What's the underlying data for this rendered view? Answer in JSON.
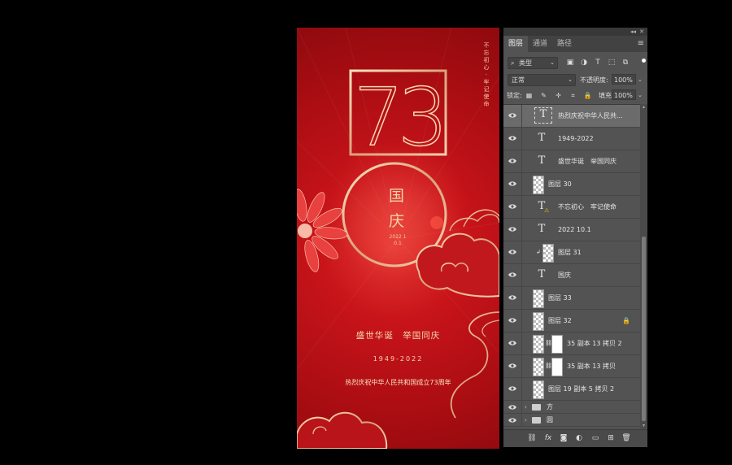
{
  "poster": {
    "big_number": "73",
    "vertical_motto": "不忘初心·牢记使命",
    "circle_title": "国庆",
    "circle_date": "2022 10.1",
    "slogan": "盛世华诞　举国同庆",
    "years": "1949-2022",
    "celebrate": "热烈庆祝中华人民共和国成立73周年"
  },
  "panel": {
    "collapse_glyph": "◂◂",
    "close_glyph": "✕",
    "tabs": [
      "图层",
      "通道",
      "路径"
    ],
    "active_tab": 0,
    "menu_glyph": "≡",
    "filter": {
      "icon": "⌕",
      "label": "类型",
      "chevron": "⌄"
    },
    "filter_icons": [
      "image-filter-icon",
      "adjustment-filter-icon",
      "type-filter-icon",
      "shape-filter-icon",
      "smart-object-filter-icon"
    ],
    "filter_glyphs": [
      "▣",
      "◑",
      "T",
      "⬚",
      "⧉"
    ],
    "blend_mode": "正常",
    "blend_chevron": "⌄",
    "opacity_label": "不透明度:",
    "opacity_value": "100%",
    "lock_label": "锁定:",
    "lock_glyphs": [
      "▦",
      "✎",
      "✛",
      "⌗",
      "🔒"
    ],
    "fill_label": "填充:",
    "fill_value": "100%",
    "chevron": "⌄",
    "layers": [
      {
        "name": "热烈庆祝中华人民共...",
        "kind": "text",
        "selected": true
      },
      {
        "name": "1949-2022",
        "kind": "text"
      },
      {
        "name": "盛世华诞　举国同庆",
        "kind": "text"
      },
      {
        "name": "图层 30",
        "kind": "pixel"
      },
      {
        "name": "不忘初心　牢记使命",
        "kind": "text",
        "warning": true
      },
      {
        "name": "2022 10.1",
        "kind": "text"
      },
      {
        "name": "图层 31",
        "kind": "pixel",
        "clipped": true
      },
      {
        "name": "国庆",
        "kind": "text"
      },
      {
        "name": "图层 33",
        "kind": "pixel"
      },
      {
        "name": "图层 32",
        "kind": "pixel",
        "locked": true
      },
      {
        "name": "35 副本 13 拷贝 2",
        "kind": "masked"
      },
      {
        "name": "35 副本 13 拷贝",
        "kind": "masked"
      },
      {
        "name": "图层 19 副本 5 拷贝 2",
        "kind": "pixel"
      },
      {
        "name": "方",
        "kind": "group"
      },
      {
        "name": "圆",
        "kind": "group"
      }
    ],
    "type_glyph": "T",
    "link_glyph": "⛓",
    "clip_glyph": "↲",
    "lock_glyph": "🔒",
    "warn_glyph": "⚠",
    "group_chevron": "›",
    "scroll_up": "▴",
    "scroll_down": "▾",
    "bottom_icons": [
      "link-layers-icon",
      "fx-icon",
      "add-mask-icon",
      "adjustment-layer-icon",
      "new-group-icon",
      "new-layer-icon",
      "delete-layer-icon"
    ],
    "bottom_glyphs": [
      "⛓",
      "fx",
      "◙",
      "◐",
      "▭",
      "⊞",
      "🗑"
    ]
  }
}
